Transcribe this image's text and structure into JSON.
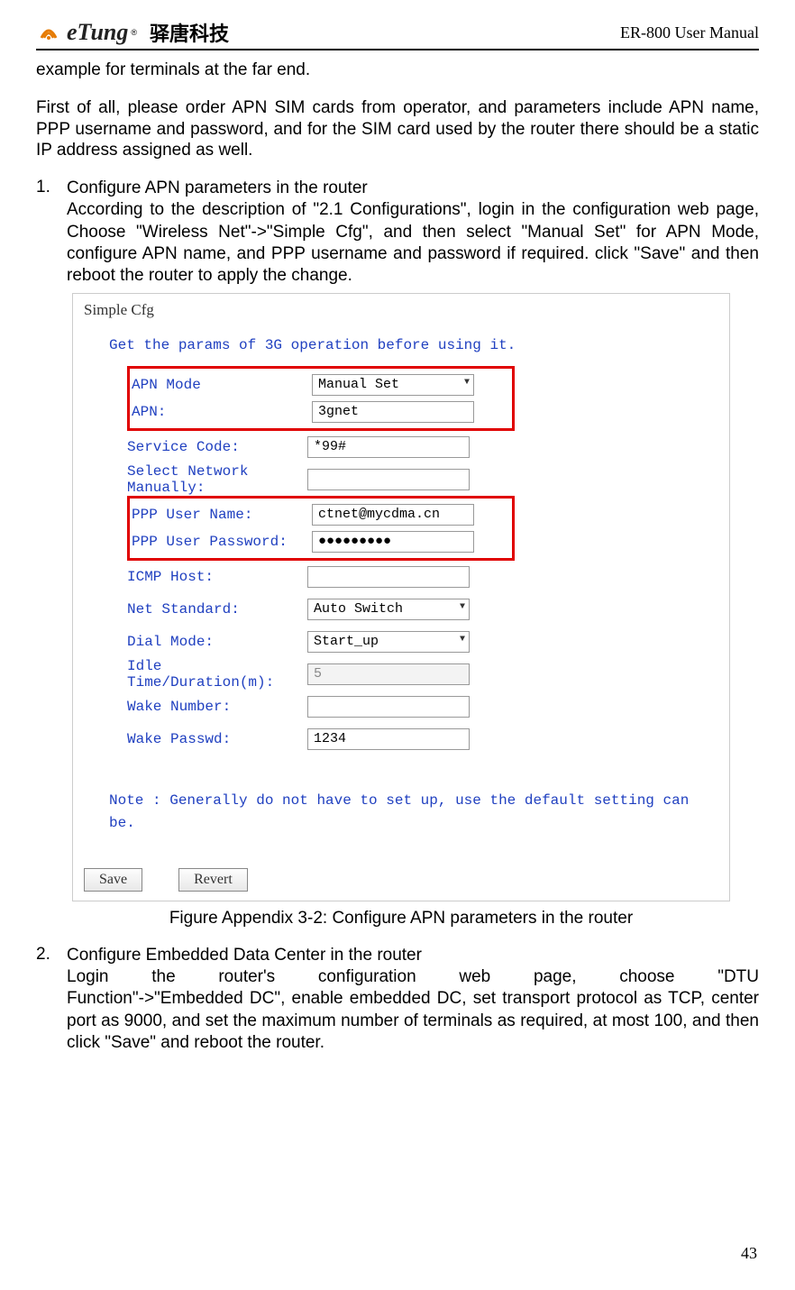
{
  "header": {
    "logo_text": "eTung",
    "logo_tm": "®",
    "logo_cn": "驿唐科技",
    "right": "ER-800 User Manual"
  },
  "intro_line": "example for terminals at the far end.",
  "para2": "First of all, please order APN SIM cards from operator, and parameters include APN name, PPP username and password, and for the SIM card used by the router there should be a static IP address assigned as well.",
  "item1": {
    "num": "1.",
    "title": "Configure APN parameters in the router",
    "body": "According to the description of \"2.1 Configurations\", login in the configuration web page, Choose \"Wireless Net\"->\"Simple Cfg\", and then select \"Manual Set\" for APN Mode, configure APN name, and PPP username and password if required. click \"Save\" and then reboot the router to apply the change."
  },
  "figure": {
    "title": "Simple Cfg",
    "subtitle": "Get the params of 3G operation before using it.",
    "rows": {
      "apn_mode_label": "APN Mode",
      "apn_mode_value": "Manual Set",
      "apn_label": "APN:",
      "apn_value": "3gnet",
      "service_code_label": "Service Code:",
      "service_code_value": "*99#",
      "select_net_label": "Select Network Manually:",
      "select_net_value": "",
      "ppp_user_label": "PPP User Name:",
      "ppp_user_value": "ctnet@mycdma.cn",
      "ppp_pass_label": "PPP User Password:",
      "ppp_pass_value": "●●●●●●●●●",
      "icmp_label": "ICMP Host:",
      "icmp_value": "",
      "net_std_label": "Net Standard:",
      "net_std_value": "Auto Switch",
      "dial_mode_label": "Dial Mode:",
      "dial_mode_value": "Start_up",
      "idle_label": "Idle Time/Duration(m):",
      "idle_value": "5",
      "wake_num_label": "Wake Number:",
      "wake_num_value": "",
      "wake_pass_label": "Wake Passwd:",
      "wake_pass_value": "1234"
    },
    "note": "Note : Generally do not have to set up, use the default setting can be.",
    "save_btn": "Save",
    "revert_btn": "Revert",
    "caption": "Figure Appendix 3-2: Configure APN parameters in the router"
  },
  "item2": {
    "num": "2.",
    "title": "Configure Embedded Data Center in the router",
    "body_line1_words": [
      "Login",
      "the",
      "router's",
      "configuration",
      "web",
      "page,",
      "choose",
      "\"DTU"
    ],
    "body_rest": "Function\"->\"Embedded DC\", enable embedded DC, set transport protocol as TCP, center port as 9000, and set the maximum number of terminals as required, at most 100, and then click \"Save\" and reboot the router."
  },
  "page_num": "43"
}
